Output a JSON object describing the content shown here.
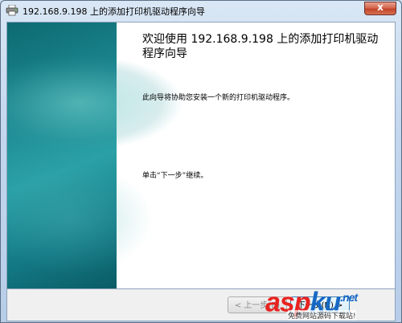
{
  "window": {
    "title": "192.168.9.198 上的添加打印机驱动程序向导",
    "close_symbol": "x"
  },
  "wizard": {
    "heading": "欢迎使用 192.168.9.198 上的添加打印机驱动程序向导",
    "description": "此向导将协助您安装一个新的打印机驱动程序。",
    "instruction": "单击“下一步”继续。"
  },
  "buttons": {
    "back_label": "< 上一步(B)",
    "next_label": "下一步(N) >"
  },
  "watermark": {
    "logo_a": "asp",
    "logo_b": "ku",
    "logo_c": ".net",
    "subtitle": "免费网站源码下载站!"
  },
  "icons": {
    "app": "printer-icon",
    "close": "close-icon"
  },
  "colors": {
    "banner": "#1c8790",
    "close_button": "#c2432a",
    "watermark_red": "#e8231f",
    "watermark_blue": "#1768c4"
  }
}
